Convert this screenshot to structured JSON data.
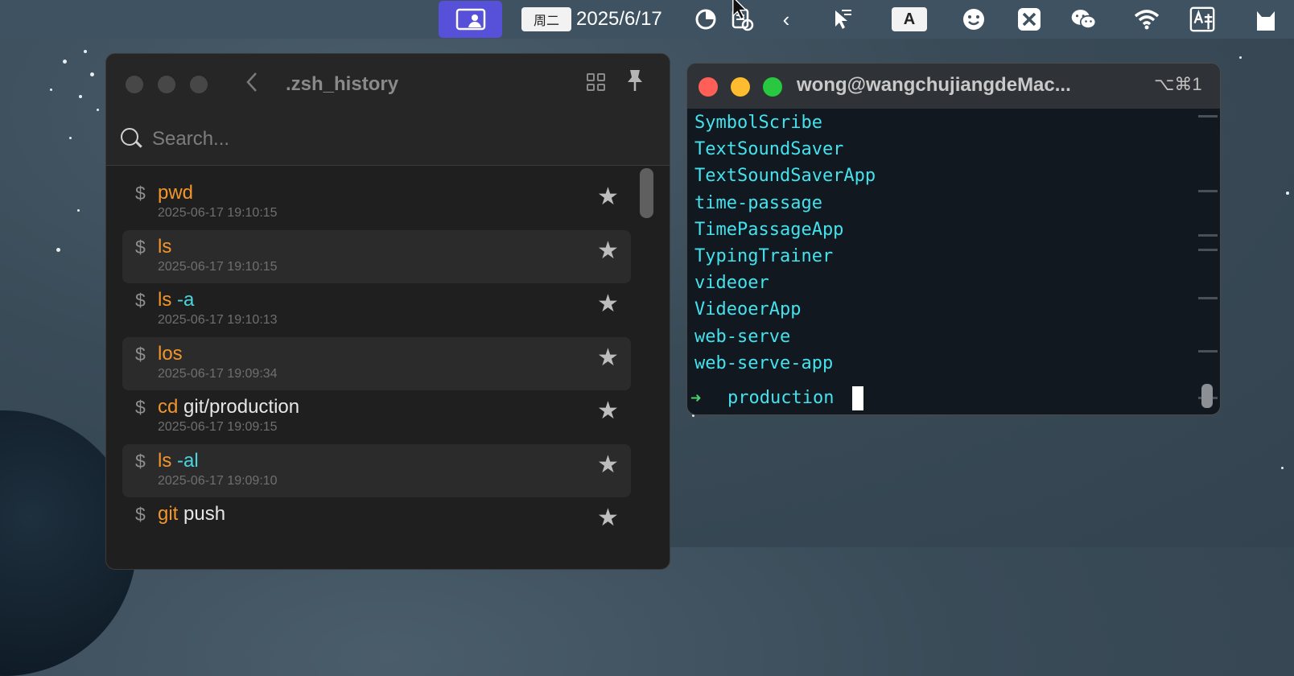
{
  "menubar": {
    "weekday": "周二",
    "date": "2025/6/17",
    "input_method_label": "A"
  },
  "history_window": {
    "title": ".zsh_history",
    "search_placeholder": "Search...",
    "items": [
      {
        "prompt": "$",
        "parts": [
          {
            "text": "pwd",
            "color": "#f2962b"
          }
        ],
        "timestamp": "2025-06-17 19:10:15",
        "starred": false
      },
      {
        "prompt": "$",
        "parts": [
          {
            "text": "ls",
            "color": "#f2962b"
          }
        ],
        "timestamp": "2025-06-17 19:10:15",
        "starred": false
      },
      {
        "prompt": "$",
        "parts": [
          {
            "text": "ls",
            "color": "#f2962b"
          },
          {
            "text": " -a",
            "color": "#48d6e0"
          }
        ],
        "timestamp": "2025-06-17 19:10:13",
        "starred": false
      },
      {
        "prompt": "$",
        "parts": [
          {
            "text": "los",
            "color": "#f2962b"
          }
        ],
        "timestamp": "2025-06-17 19:09:34",
        "starred": false
      },
      {
        "prompt": "$",
        "parts": [
          {
            "text": "cd",
            "color": "#f2962b"
          },
          {
            "text": " git/production",
            "color": "#e6e6e6"
          }
        ],
        "timestamp": "2025-06-17 19:09:15",
        "starred": false
      },
      {
        "prompt": "$",
        "parts": [
          {
            "text": "ls",
            "color": "#f2962b"
          },
          {
            "text": " -al",
            "color": "#48d6e0"
          }
        ],
        "timestamp": "2025-06-17 19:09:10",
        "starred": false
      },
      {
        "prompt": "$",
        "parts": [
          {
            "text": "git",
            "color": "#f2962b"
          },
          {
            "text": " push",
            "color": "#e6e6e6"
          }
        ],
        "timestamp": "",
        "starred": false
      }
    ]
  },
  "terminal": {
    "title": "wong@wangchujiangdeMac...",
    "shortcut": "⌥⌘1",
    "output_lines": [
      "SymbolScribe",
      "TextSoundSaver",
      "TextSoundSaverApp",
      "time-passage",
      "TimePassageApp",
      "TypingTrainer",
      "videoer",
      "VideoerApp",
      "web-serve",
      "web-serve-app"
    ],
    "prompt_symbol": "➜",
    "prompt_dir": "production"
  },
  "colors": {
    "focus_accent": "#5750d8",
    "command_orange": "#f2962b",
    "arg_cyan": "#48d6e0",
    "terminal_text": "#44e2ec",
    "prompt_green": "#4fd16a",
    "traffic_red": "#ff5f57",
    "traffic_yellow": "#febc2e",
    "traffic_green": "#28c840"
  }
}
